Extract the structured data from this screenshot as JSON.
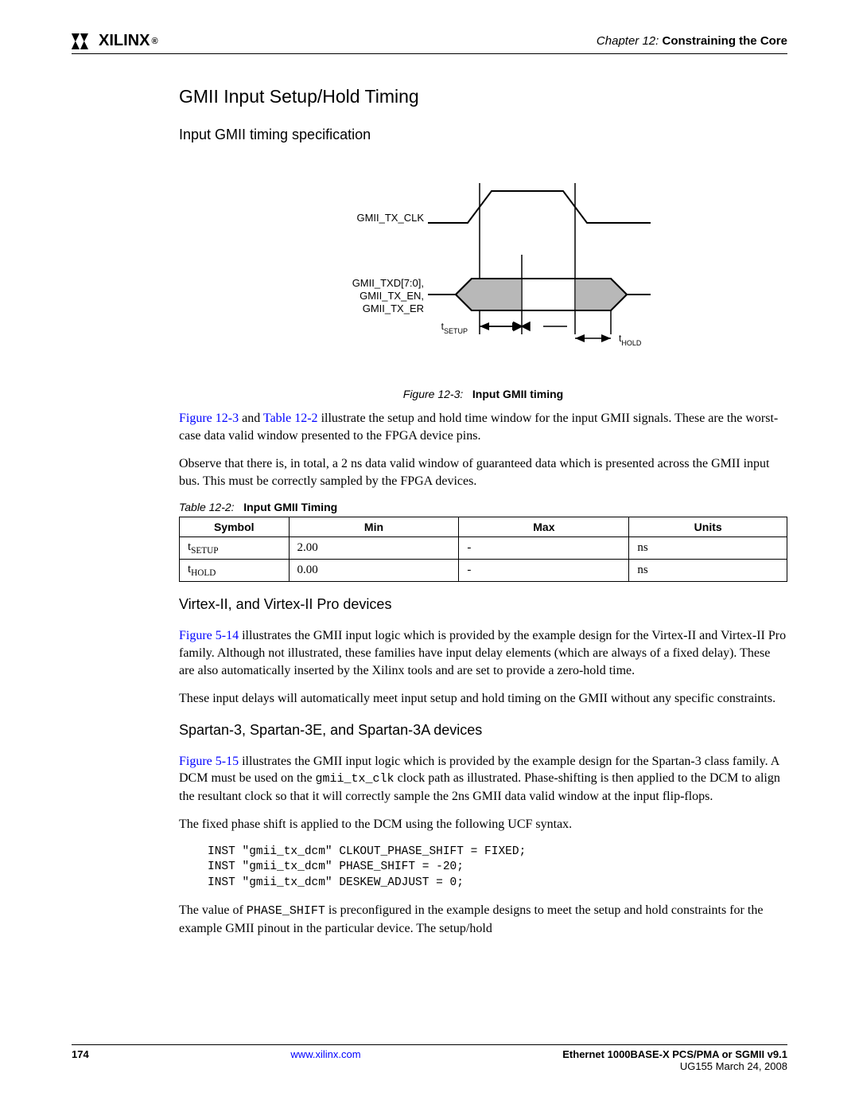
{
  "header": {
    "logo_text": "XILINX",
    "logo_reg": "®",
    "chapter_prefix": "Chapter 12:",
    "chapter_title": "Constraining the Core"
  },
  "section_h2": "GMII Input Setup/Hold Timing",
  "subsection_h3_1": "Input GMII timing specification",
  "figure": {
    "clk_label": "GMII_TX_CLK",
    "data_label_1": "GMII_TXD[7:0],",
    "data_label_2": "GMII_TX_EN,",
    "data_label_3": "GMII_TX_ER",
    "tsetup": "SETUP",
    "thold": "HOLD",
    "caption_prefix": "Figure 12-3:",
    "caption_title": "Input GMII timing"
  },
  "para_1_a": "Figure 12-3",
  "para_1_b": " and ",
  "para_1_c": "Table 12-2",
  "para_1_d": " illustrate the setup and hold time window for the input GMII signals. These are the worst-case data valid window presented to the FPGA device pins.",
  "para_2": "Observe that there is, in total, a 2 ns data valid window of guaranteed data which is presented across the GMII input bus. This must be correctly sampled by the FPGA devices.",
  "table": {
    "caption_prefix": "Table 12-2:",
    "caption_title": "Input GMII Timing",
    "cols": [
      "Symbol",
      "Min",
      "Max",
      "Units"
    ],
    "rows": [
      {
        "sym_pre": "t",
        "sym_sub": "SETUP",
        "min": "2.00",
        "max": "-",
        "units": "ns"
      },
      {
        "sym_pre": "t",
        "sym_sub": "HOLD",
        "min": "0.00",
        "max": "-",
        "units": "ns"
      }
    ]
  },
  "subsection_h3_2": "Virtex-II, and Virtex-II Pro devices",
  "para_3_a": "Figure 5-14",
  "para_3_b": " illustrates the GMII input logic which is provided by the example design for the Virtex-II and Virtex-II Pro family. Although not illustrated, these families have input delay elements (which are always of a fixed delay). These are also automatically inserted by the Xilinx tools and are set to provide a zero-hold time.",
  "para_4": "These input delays will automatically meet input setup and hold timing on the GMII without any specific constraints.",
  "subsection_h3_3": "Spartan-3, Spartan-3E, and Spartan-3A devices",
  "para_5_a": "Figure 5-15",
  "para_5_b": " illustrates the GMII input logic which is provided by the example design for the Spartan-3 class family. A DCM must be used on the ",
  "para_5_code": "gmii_tx_clk",
  "para_5_c": " clock path as illustrated. Phase-shifting is then applied to the DCM to align the resultant clock so that it will correctly sample the 2ns GMII data valid window at the input flip-flops.",
  "para_6": "The fixed phase shift is applied to the DCM using the following UCF syntax.",
  "codeblock": "INST \"gmii_tx_dcm\" CLKOUT_PHASE_SHIFT = FIXED;\nINST \"gmii_tx_dcm\" PHASE_SHIFT = -20;\nINST \"gmii_tx_dcm\" DESKEW_ADJUST = 0;",
  "para_7_a": "The value of ",
  "para_7_code": "PHASE_SHIFT",
  "para_7_b": " is preconfigured in the example designs to meet the setup and hold constraints for the example GMII pinout in the particular device. The setup/hold",
  "footer": {
    "page": "174",
    "url": "www.xilinx.com",
    "title": "Ethernet 1000BASE-X PCS/PMA or SGMII v9.1",
    "docid": "UG155 March 24, 2008"
  },
  "chart_data": {
    "type": "table",
    "title": "Input GMII Timing",
    "columns": [
      "Symbol",
      "Min",
      "Max",
      "Units"
    ],
    "rows": [
      [
        "tSETUP",
        2.0,
        null,
        "ns"
      ],
      [
        "tHOLD",
        0.0,
        null,
        "ns"
      ]
    ]
  }
}
